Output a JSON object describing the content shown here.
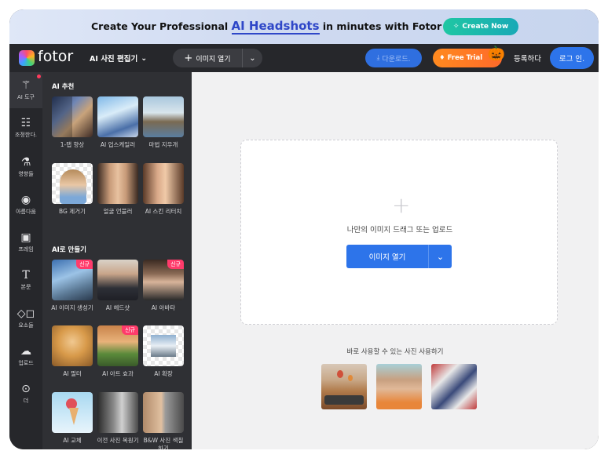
{
  "banner": {
    "text_before": "Create Your Professional ",
    "highlight": "AI Headshots",
    "text_after": " in minutes with Fotor AI.",
    "cta_label": "Create Now"
  },
  "topbar": {
    "logo_text": "fotor",
    "menu_label": "AI 사진 편집기",
    "open_image_label": "이미지 열기",
    "download_label": "다운로드.",
    "free_trial_label": "Free Trial",
    "register_label": "등록하다",
    "login_label": "로그 인."
  },
  "rail": {
    "items": [
      {
        "label": "AI 도구",
        "icon": "magic-wand-icon"
      },
      {
        "label": "조정한다.",
        "icon": "sliders-icon"
      },
      {
        "label": "영향들",
        "icon": "flask-icon"
      },
      {
        "label": "아름다움",
        "icon": "eye-icon"
      },
      {
        "label": "프레임",
        "icon": "frame-icon"
      },
      {
        "label": "본문",
        "icon": "text-icon"
      },
      {
        "label": "요소들",
        "icon": "shapes-icon"
      },
      {
        "label": "업로드",
        "icon": "upload-cloud-icon"
      },
      {
        "label": "더",
        "icon": "more-icon"
      }
    ]
  },
  "panel": {
    "section_ai_recommend": "AI 추천",
    "section_ai_create": "AI로 만들기",
    "recommend_tools": [
      {
        "label": "1-탭 향상"
      },
      {
        "label": "AI 업스케일러"
      },
      {
        "label": "마법 지우개"
      },
      {
        "label": "BG 제거기"
      },
      {
        "label": "얼굴 언블러"
      },
      {
        "label": "AI 스킨 리터치"
      }
    ],
    "create_tools": [
      {
        "label": "AI 이미지 생성기",
        "badge": "신규"
      },
      {
        "label": "AI 헤드샷",
        "badge": ""
      },
      {
        "label": "AI 아바타",
        "badge": "신규"
      },
      {
        "label": "AI 필터",
        "badge": ""
      },
      {
        "label": "AI 아트 효과",
        "badge": "신규"
      },
      {
        "label": "AI 확장",
        "badge": ""
      },
      {
        "label": "AI 교체",
        "badge": ""
      },
      {
        "label": "이전 사진 복원기",
        "badge": ""
      },
      {
        "label": "B&W 사진 색칠하기",
        "badge": ""
      }
    ]
  },
  "canvas": {
    "drop_text": "나만의 이미지 드래그 또는 업로드",
    "open_button_label": "이미지 열기",
    "samples_label": "바로 사용할 수 있는 사진 사용하기"
  },
  "colors": {
    "accent_blue": "#2d74ea",
    "badge_pink": "#ff3b6b",
    "trial_orange": "#ff8a1f",
    "create_teal": "#1fc7a3"
  }
}
